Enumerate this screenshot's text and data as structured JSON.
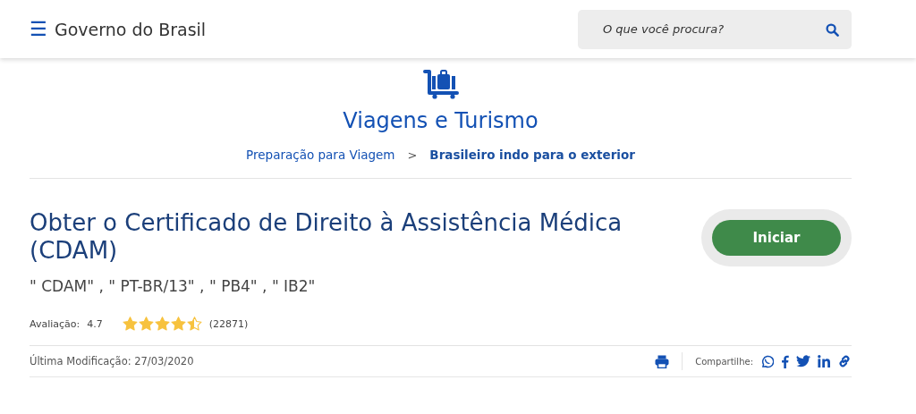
{
  "header": {
    "menu_icon": "☰",
    "site_name": "Governo do Brasil",
    "search": {
      "placeholder": "O que você procura?"
    }
  },
  "category": {
    "title": "Viagens e Turismo"
  },
  "breadcrumb": [
    {
      "label": "Preparação para Viagem",
      "current": false
    },
    {
      "label": "Brasileiro indo para o exterior",
      "current": true
    }
  ],
  "breadcrumb_separator": ">",
  "service": {
    "title": "Obter o Certificado de Direito à Assistência Médica (CDAM)",
    "aliases": "\" CDAM\" , \" PT-BR/13\" , \" PB4\" , \" IB2\"",
    "start_button": "Iniciar"
  },
  "rating": {
    "label": "Avaliação:",
    "score": "4.7",
    "stars": 4.5,
    "count": "(22871)"
  },
  "footer": {
    "last_modified": "Última Modificação: 27/03/2020",
    "share_label": "Compartilhe:"
  }
}
